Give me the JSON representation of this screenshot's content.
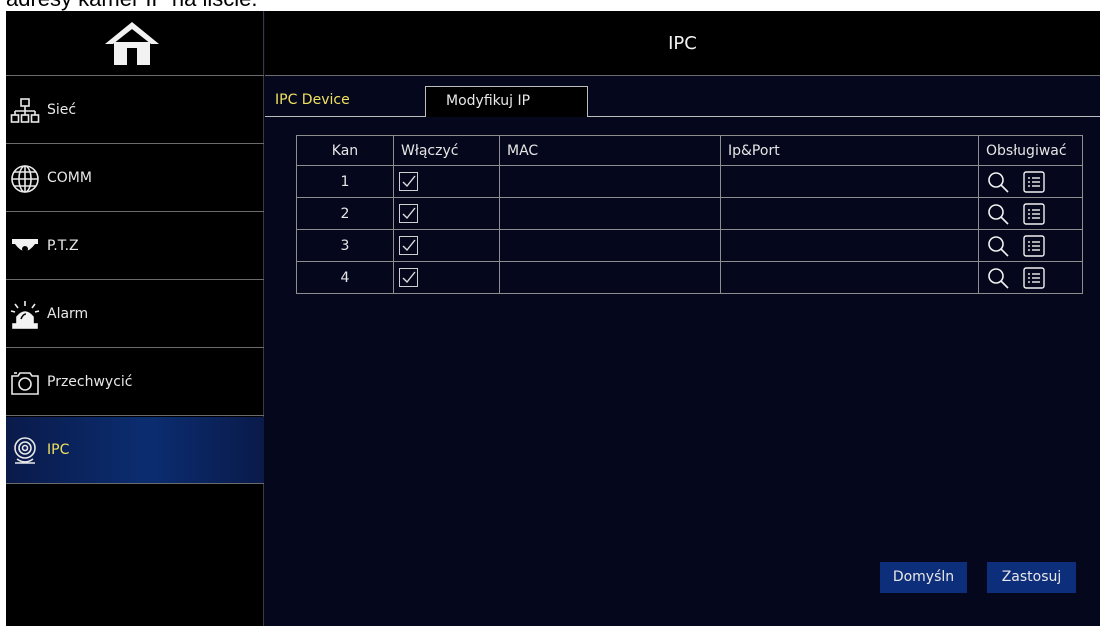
{
  "caption": "adresy kamer IP na liście.",
  "header": {
    "title": "IPC"
  },
  "sidebar": {
    "items": [
      {
        "label": "Sieć",
        "icon": "network-icon"
      },
      {
        "label": "COMM",
        "icon": "globe-icon"
      },
      {
        "label": "P.T.Z",
        "icon": "dome-camera-icon"
      },
      {
        "label": "Alarm",
        "icon": "siren-icon"
      },
      {
        "label": "Przechwycić",
        "icon": "camera-icon"
      },
      {
        "label": "IPC",
        "icon": "ip-camera-icon",
        "active": true
      }
    ]
  },
  "tabs": [
    {
      "label": "IPC Device",
      "active": true
    },
    {
      "label": "Modyfikuj IP",
      "active": false
    }
  ],
  "table": {
    "columns": [
      "Kan",
      "Włączyć",
      "MAC",
      "Ip&Port",
      "Obsługiwać"
    ],
    "rows": [
      {
        "kan": "1",
        "enabled": true,
        "mac": "",
        "ip_port": ""
      },
      {
        "kan": "2",
        "enabled": true,
        "mac": "",
        "ip_port": ""
      },
      {
        "kan": "3",
        "enabled": true,
        "mac": "",
        "ip_port": ""
      },
      {
        "kan": "4",
        "enabled": true,
        "mac": "",
        "ip_port": ""
      }
    ]
  },
  "buttons": {
    "default_label": "Domyśln",
    "apply_label": "Zastosuj"
  },
  "colors": {
    "background": "#05071c",
    "active_label": "#f0e060",
    "button": "#0d2e7a"
  }
}
